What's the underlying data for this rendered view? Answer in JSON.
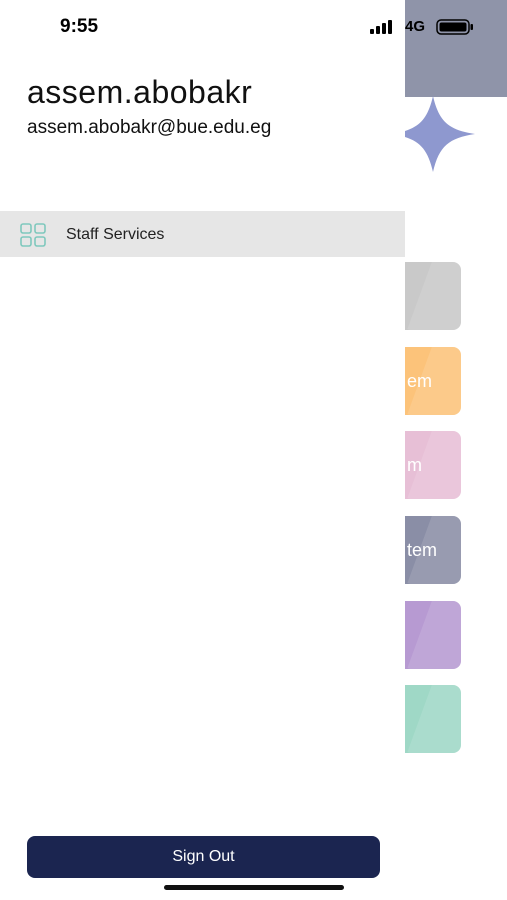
{
  "status_bar": {
    "time": "9:55",
    "network": "4G"
  },
  "drawer": {
    "user_name": "assem.abobakr",
    "user_email": "assem.abobakr@bue.edu.eg",
    "menu_items": [
      {
        "label": "Staff Services",
        "icon": "grid-icon"
      }
    ],
    "sign_out_label": "Sign Out"
  },
  "background_tiles": [
    {
      "text": "",
      "color": "#c9c9c9"
    },
    {
      "text": "em",
      "color": "#fcc37a"
    },
    {
      "text": "m",
      "color": "#e7bfd6"
    },
    {
      "text": "tem",
      "color": "#8a8ea6"
    },
    {
      "text": "",
      "color": "#b79ad2"
    },
    {
      "text": "",
      "color": "#9fd8c6"
    }
  ],
  "colors": {
    "header": "#8f94a9",
    "accent_star": "#8e98cf",
    "sign_out_bg": "#1b2550",
    "menu_highlight": "#e6e6e6",
    "icon_teal": "#7fc8bd"
  }
}
